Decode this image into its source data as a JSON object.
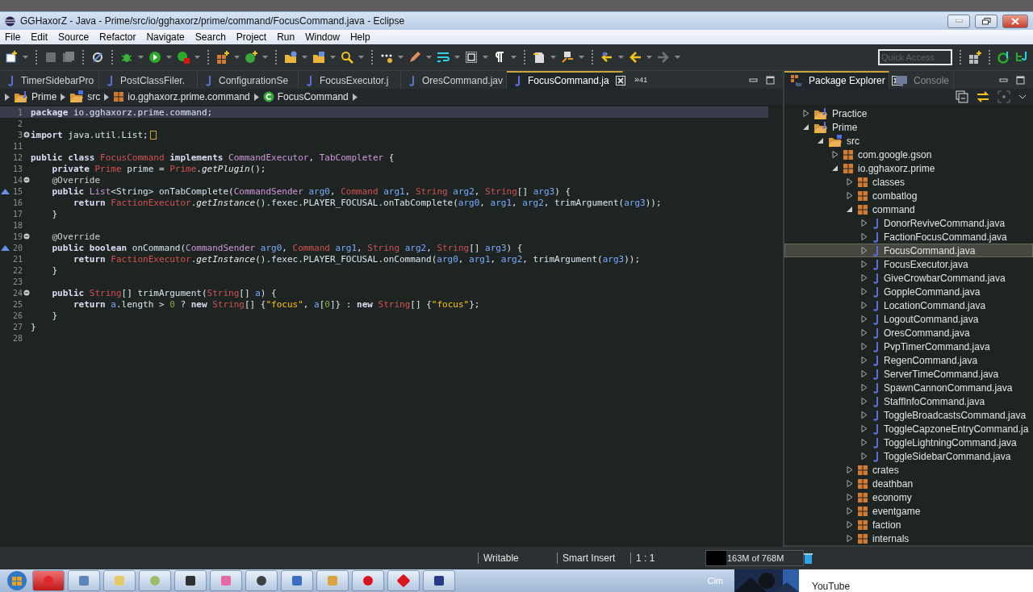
{
  "window": {
    "title": "GGHaxorZ - Java - Prime/src/io/gghaxorz/prime/command/FocusCommand.java - Eclipse"
  },
  "menu": [
    "File",
    "Edit",
    "Source",
    "Refactor",
    "Navigate",
    "Search",
    "Project",
    "Run",
    "Window",
    "Help"
  ],
  "quick_access": {
    "placeholder": "Quick Access"
  },
  "editor_tabs": [
    {
      "label": "TimerSidebarPro",
      "selected": false
    },
    {
      "label": "PostClassFiler.",
      "selected": false
    },
    {
      "label": "ConfigurationSe",
      "selected": false
    },
    {
      "label": "FocusExecutor.j",
      "selected": false
    },
    {
      "label": "OresCommand.jav",
      "selected": false
    },
    {
      "label": "FocusCommand.ja",
      "selected": true
    }
  ],
  "tab_overflow": {
    "symbol": "»",
    "count": "41"
  },
  "breadcrumb": [
    {
      "label": "Prime",
      "kind": "project"
    },
    {
      "label": "src",
      "kind": "srcfolder"
    },
    {
      "label": "io.gghaxorz.prime.command",
      "kind": "package"
    },
    {
      "label": "FocusCommand",
      "kind": "class"
    }
  ],
  "code": [
    {
      "num": "1",
      "current": true,
      "kind": "plain",
      "tokens": [
        {
          "kind": "keyword",
          "text": "package"
        },
        {
          "kind": "plain",
          "text": " io.gghaxorz.prime.command;"
        }
      ]
    },
    {
      "num": "2",
      "current": false,
      "kind": "plain"
    },
    {
      "num": "3",
      "current": false,
      "kind": "folded",
      "tokens": [
        {
          "kind": "keyword",
          "text": "import"
        },
        {
          "kind": "plain",
          "text": " java.util.List;"
        }
      ]
    },
    {
      "num": "11",
      "current": false,
      "kind": "plain"
    },
    {
      "num": "12",
      "current": false,
      "kind": "plain",
      "tokens": [
        {
          "kind": "keyword",
          "text": "public class "
        },
        {
          "kind": "class",
          "text": "FocusCommand"
        },
        {
          "kind": "keyword",
          "text": " implements "
        },
        {
          "kind": "interface",
          "text": "CommandExecutor"
        },
        {
          "kind": "plain",
          "text": ", "
        },
        {
          "kind": "interface",
          "text": "TabCompleter"
        },
        {
          "kind": "plain",
          "text": " {"
        }
      ]
    },
    {
      "num": "13",
      "current": false,
      "kind": "plain",
      "tokens": [
        {
          "kind": "keyword",
          "text": "    private "
        },
        {
          "kind": "class",
          "text": "Prime"
        },
        {
          "kind": "plain",
          "text": " prime = "
        },
        {
          "kind": "class",
          "text": "Prime"
        },
        {
          "kind": "plain",
          "text": "."
        },
        {
          "kind": "method",
          "text": "getPlugin"
        },
        {
          "kind": "plain",
          "text": "();"
        }
      ]
    },
    {
      "num": "14",
      "current": false,
      "kind": "foldable",
      "tokens": [
        {
          "kind": "annotation",
          "text": "    @Override"
        }
      ]
    },
    {
      "num": "15",
      "current": false,
      "kind": "override",
      "tokens": [
        {
          "kind": "keyword",
          "text": "    public "
        },
        {
          "kind": "interface",
          "text": "List"
        },
        {
          "kind": "plain",
          "text": "<String> onTabComplete("
        },
        {
          "kind": "interface",
          "text": "CommandSender"
        },
        {
          "kind": "param",
          "text": " arg0"
        },
        {
          "kind": "plain",
          "text": ", "
        },
        {
          "kind": "class",
          "text": "Command"
        },
        {
          "kind": "param",
          "text": " arg1"
        },
        {
          "kind": "plain",
          "text": ", "
        },
        {
          "kind": "class",
          "text": "String"
        },
        {
          "kind": "param",
          "text": " arg2"
        },
        {
          "kind": "plain",
          "text": ", "
        },
        {
          "kind": "class",
          "text": "String"
        },
        {
          "kind": "plain",
          "text": "[]"
        },
        {
          "kind": "param",
          "text": " arg3"
        },
        {
          "kind": "plain",
          "text": ") {"
        }
      ]
    },
    {
      "num": "16",
      "current": false,
      "kind": "plain",
      "tokens": [
        {
          "kind": "keyword",
          "text": "        return "
        },
        {
          "kind": "class",
          "text": "FactionExecutor"
        },
        {
          "kind": "plain",
          "text": "."
        },
        {
          "kind": "method",
          "text": "getInstance"
        },
        {
          "kind": "plain",
          "text": "().fexec.PLAYER_FOCUSAL.onTabComplete("
        },
        {
          "kind": "param",
          "text": "arg0"
        },
        {
          "kind": "plain",
          "text": ", "
        },
        {
          "kind": "param",
          "text": "arg1"
        },
        {
          "kind": "plain",
          "text": ", "
        },
        {
          "kind": "param",
          "text": "arg2"
        },
        {
          "kind": "plain",
          "text": ", trimArgument("
        },
        {
          "kind": "param",
          "text": "arg3"
        },
        {
          "kind": "plain",
          "text": "));"
        }
      ]
    },
    {
      "num": "17",
      "current": false,
      "kind": "plain",
      "tokens": [
        {
          "kind": "plain",
          "text": "    }"
        }
      ]
    },
    {
      "num": "18",
      "current": false,
      "kind": "plain"
    },
    {
      "num": "19",
      "current": false,
      "kind": "foldable",
      "tokens": [
        {
          "kind": "annotation",
          "text": "    @Override"
        }
      ]
    },
    {
      "num": "20",
      "current": false,
      "kind": "override",
      "tokens": [
        {
          "kind": "keyword",
          "text": "    public boolean "
        },
        {
          "kind": "plain",
          "text": "onCommand("
        },
        {
          "kind": "interface",
          "text": "CommandSender"
        },
        {
          "kind": "param",
          "text": " arg0"
        },
        {
          "kind": "plain",
          "text": ", "
        },
        {
          "kind": "class",
          "text": "Command"
        },
        {
          "kind": "param",
          "text": " arg1"
        },
        {
          "kind": "plain",
          "text": ", "
        },
        {
          "kind": "class",
          "text": "String"
        },
        {
          "kind": "param",
          "text": " arg2"
        },
        {
          "kind": "plain",
          "text": ", "
        },
        {
          "kind": "class",
          "text": "String"
        },
        {
          "kind": "plain",
          "text": "[]"
        },
        {
          "kind": "param",
          "text": " arg3"
        },
        {
          "kind": "plain",
          "text": ") {"
        }
      ]
    },
    {
      "num": "21",
      "current": false,
      "kind": "plain",
      "tokens": [
        {
          "kind": "keyword",
          "text": "        return "
        },
        {
          "kind": "class",
          "text": "FactionExecutor"
        },
        {
          "kind": "plain",
          "text": "."
        },
        {
          "kind": "method",
          "text": "getInstance"
        },
        {
          "kind": "plain",
          "text": "().fexec.PLAYER_FOCUSAL.onCommand("
        },
        {
          "kind": "param",
          "text": "arg0"
        },
        {
          "kind": "plain",
          "text": ", "
        },
        {
          "kind": "param",
          "text": "arg1"
        },
        {
          "kind": "plain",
          "text": ", "
        },
        {
          "kind": "param",
          "text": "arg2"
        },
        {
          "kind": "plain",
          "text": ", trimArgument("
        },
        {
          "kind": "param",
          "text": "arg3"
        },
        {
          "kind": "plain",
          "text": "));"
        }
      ]
    },
    {
      "num": "22",
      "current": false,
      "kind": "plain",
      "tokens": [
        {
          "kind": "plain",
          "text": "    }"
        }
      ]
    },
    {
      "num": "23",
      "current": false,
      "kind": "plain"
    },
    {
      "num": "24",
      "current": false,
      "kind": "foldable",
      "tokens": [
        {
          "kind": "keyword",
          "text": "    public "
        },
        {
          "kind": "class",
          "text": "String"
        },
        {
          "kind": "plain",
          "text": "[] trimArgument("
        },
        {
          "kind": "class",
          "text": "String"
        },
        {
          "kind": "plain",
          "text": "[]"
        },
        {
          "kind": "param",
          "text": " a"
        },
        {
          "kind": "plain",
          "text": ") {"
        }
      ]
    },
    {
      "num": "25",
      "current": false,
      "kind": "plain",
      "tokens": [
        {
          "kind": "keyword",
          "text": "        return "
        },
        {
          "kind": "param",
          "text": "a"
        },
        {
          "kind": "plain",
          "text": ".length > "
        },
        {
          "kind": "number",
          "text": "0"
        },
        {
          "kind": "plain",
          "text": " ? "
        },
        {
          "kind": "keyword",
          "text": "new "
        },
        {
          "kind": "class",
          "text": "String"
        },
        {
          "kind": "plain",
          "text": "[] {"
        },
        {
          "kind": "string",
          "text": "\"focus\""
        },
        {
          "kind": "plain",
          "text": ", "
        },
        {
          "kind": "param",
          "text": "a"
        },
        {
          "kind": "plain",
          "text": "["
        },
        {
          "kind": "number",
          "text": "0"
        },
        {
          "kind": "plain",
          "text": "]} : "
        },
        {
          "kind": "keyword",
          "text": "new "
        },
        {
          "kind": "class",
          "text": "String"
        },
        {
          "kind": "plain",
          "text": "[] {"
        },
        {
          "kind": "string",
          "text": "\"focus\""
        },
        {
          "kind": "plain",
          "text": "};"
        }
      ]
    },
    {
      "num": "26",
      "current": false,
      "kind": "plain",
      "tokens": [
        {
          "kind": "plain",
          "text": "    }"
        }
      ]
    },
    {
      "num": "27",
      "current": false,
      "kind": "plain",
      "tokens": [
        {
          "kind": "plain",
          "text": "}"
        }
      ]
    },
    {
      "num": "28",
      "current": false,
      "kind": "plain"
    }
  ],
  "side_tabs": [
    {
      "label": "Package Explorer",
      "selected": true
    },
    {
      "label": "Console",
      "selected": false
    }
  ],
  "tree": [
    {
      "label": "Practice",
      "kind": "project",
      "expanded": false,
      "selected": false
    },
    {
      "label": "Prime",
      "kind": "project",
      "expanded": true,
      "selected": false,
      "children": [
        {
          "label": "src",
          "kind": "srcfolder",
          "expanded": true,
          "selected": false,
          "children": [
            {
              "label": "com.google.gson",
              "kind": "package",
              "expanded": false,
              "selected": false
            },
            {
              "label": "io.gghaxorz.prime",
              "kind": "package",
              "expanded": true,
              "selected": false,
              "children": [
                {
                  "label": "classes",
                  "kind": "package",
                  "expanded": false,
                  "selected": false
                },
                {
                  "label": "combatlog",
                  "kind": "package",
                  "expanded": false,
                  "selected": false
                },
                {
                  "label": "command",
                  "kind": "package",
                  "expanded": true,
                  "selected": false,
                  "children": [
                    {
                      "label": "DonorReviveCommand.java",
                      "kind": "java",
                      "expanded": false,
                      "selected": false
                    },
                    {
                      "label": "FactionFocusCommand.java",
                      "kind": "java",
                      "expanded": false,
                      "selected": false
                    },
                    {
                      "label": "FocusCommand.java",
                      "kind": "java",
                      "expanded": false,
                      "selected": true
                    },
                    {
                      "label": "FocusExecutor.java",
                      "kind": "java",
                      "expanded": false,
                      "selected": false
                    },
                    {
                      "label": "GiveCrowbarCommand.java",
                      "kind": "java",
                      "expanded": false,
                      "selected": false
                    },
                    {
                      "label": "GoppleCommand.java",
                      "kind": "java",
                      "expanded": false,
                      "selected": false
                    },
                    {
                      "label": "LocationCommand.java",
                      "kind": "java",
                      "expanded": false,
                      "selected": false
                    },
                    {
                      "label": "LogoutCommand.java",
                      "kind": "java",
                      "expanded": false,
                      "selected": false
                    },
                    {
                      "label": "OresCommand.java",
                      "kind": "java",
                      "expanded": false,
                      "selected": false
                    },
                    {
                      "label": "PvpTimerCommand.java",
                      "kind": "java",
                      "expanded": false,
                      "selected": false
                    },
                    {
                      "label": "RegenCommand.java",
                      "kind": "java",
                      "expanded": false,
                      "selected": false
                    },
                    {
                      "label": "ServerTimeCommand.java",
                      "kind": "java",
                      "expanded": false,
                      "selected": false
                    },
                    {
                      "label": "SpawnCannonCommand.java",
                      "kind": "java",
                      "expanded": false,
                      "selected": false
                    },
                    {
                      "label": "StaffInfoCommand.java",
                      "kind": "java",
                      "expanded": false,
                      "selected": false
                    },
                    {
                      "label": "ToggleBroadcastsCommand.java",
                      "kind": "java",
                      "expanded": false,
                      "selected": false
                    },
                    {
                      "label": "ToggleCapzoneEntryCommand.ja",
                      "kind": "java",
                      "expanded": false,
                      "selected": false
                    },
                    {
                      "label": "ToggleLightningCommand.java",
                      "kind": "java",
                      "expanded": false,
                      "selected": false
                    },
                    {
                      "label": "ToggleSidebarCommand.java",
                      "kind": "java",
                      "expanded": false,
                      "selected": false
                    }
                  ]
                },
                {
                  "label": "crates",
                  "kind": "package",
                  "expanded": false,
                  "selected": false
                },
                {
                  "label": "deathban",
                  "kind": "package",
                  "expanded": false,
                  "selected": false
                },
                {
                  "label": "economy",
                  "kind": "package",
                  "expanded": false,
                  "selected": false
                },
                {
                  "label": "eventgame",
                  "kind": "package",
                  "expanded": false,
                  "selected": false
                },
                {
                  "label": "faction",
                  "kind": "package",
                  "expanded": false,
                  "selected": false
                },
                {
                  "label": "internals",
                  "kind": "package",
                  "expanded": false,
                  "selected": false
                }
              ]
            }
          ]
        }
      ]
    }
  ],
  "status_bar": {
    "fields": [
      "Writable",
      "Smart Insert",
      "1 : 1"
    ],
    "heap": {
      "text": "163M of 768M",
      "level": 0.21
    }
  },
  "taskbar": {
    "items": [
      {
        "color": "#e0282c",
        "selected": true
      },
      {
        "color": "#5f86b8",
        "selected": false
      },
      {
        "color": "#e5c96a",
        "selected": false
      },
      {
        "color": "#9fb86a",
        "selected": false
      },
      {
        "color": "#303030",
        "selected": false
      },
      {
        "color": "#e46aa6",
        "selected": false
      },
      {
        "color": "#404040",
        "selected": false
      },
      {
        "color": "#3a6fc0",
        "selected": false
      },
      {
        "color": "#d9a441",
        "selected": false
      },
      {
        "color": "#d9141c",
        "selected": false
      },
      {
        "color": "#d9141c",
        "selected": false
      },
      {
        "color": "#2a3a8a",
        "selected": false
      }
    ],
    "label": "Cim",
    "preview_title": "YouTube"
  }
}
